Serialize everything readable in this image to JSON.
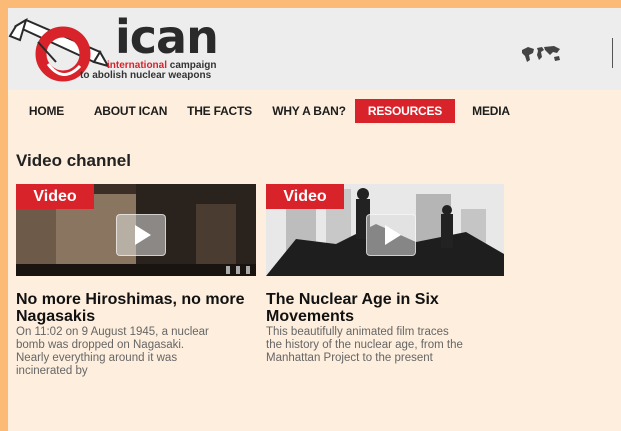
{
  "header": {
    "brand": "ican",
    "tagline_red": "international",
    "tagline_rest_line1": " campaign",
    "tagline_line2": "to abolish nuclear weapons"
  },
  "nav": {
    "items": [
      {
        "label": "HOME"
      },
      {
        "label": "ABOUT ICAN"
      },
      {
        "label": "THE FACTS"
      },
      {
        "label": "WHY A BAN?"
      },
      {
        "label": "RESOURCES"
      },
      {
        "label": "MEDIA"
      }
    ],
    "active": "RESOURCES"
  },
  "main": {
    "section_title": "Video channel",
    "videos": [
      {
        "badge": "Video",
        "title": "No more Hiroshimas, no more Nagasakis",
        "description": "On 11:02 on 9 August 1945, a nuclear bomb was dropped on Nagasaki. Nearly everything around it was incinerated by"
      },
      {
        "badge": "Video",
        "title": "The Nuclear Age in Six Movements",
        "description": "This beautifully animated film traces the history of the nuclear age, from the Manhattan Project to the present"
      }
    ]
  },
  "colors": {
    "accent": "#d8232a",
    "frame": "#fbbb77",
    "page_bg": "#fdeedd",
    "header_bg": "#ededed"
  }
}
